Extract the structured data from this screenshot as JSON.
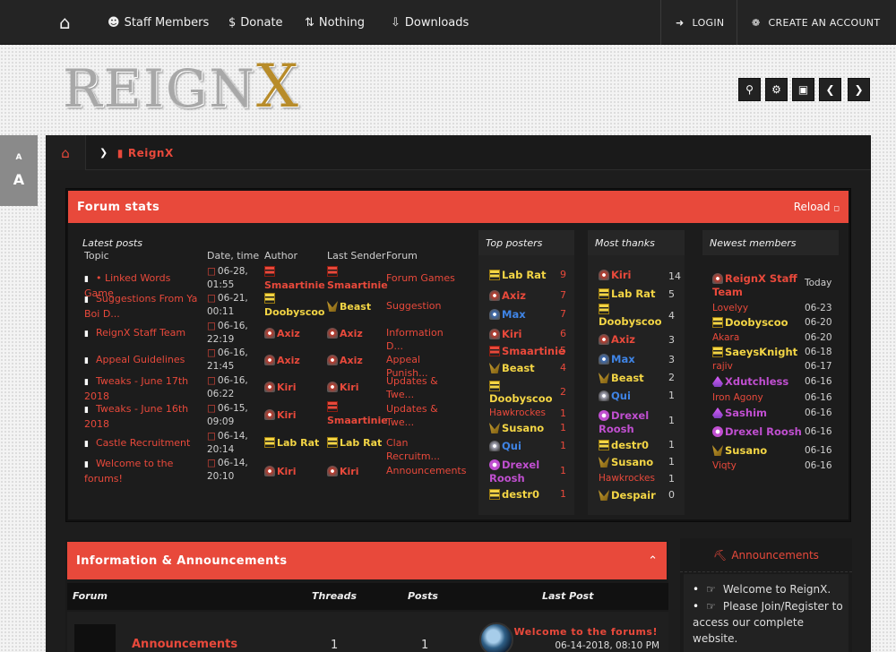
{
  "topnav": {
    "items": [
      {
        "label": "Staff Members",
        "icon": "users-icon"
      },
      {
        "label": "Donate",
        "icon": "dollar-icon"
      },
      {
        "label": "Nothing",
        "icon": "sort-icon"
      },
      {
        "label": "Downloads",
        "icon": "download-icon"
      }
    ],
    "login": "LOGIN",
    "create": "CREATE AN ACCOUNT"
  },
  "logo": {
    "text_main": "REIGN",
    "text_x": "X"
  },
  "font_size": {
    "small": "A",
    "large": "A"
  },
  "breadcrumb": {
    "label": "ReignX"
  },
  "forum_stats": {
    "title": "Forum stats",
    "reload": "Reload",
    "latest_posts": {
      "heading": "Latest posts",
      "columns": [
        "Topic",
        "Date, time",
        "Author",
        "Last Sender",
        "Forum"
      ],
      "rows": [
        {
          "topic": "• Linked Words Game",
          "date": "06-28, 01:55",
          "author": "Smaartinie",
          "sender": "Smaartinie",
          "forum": "Forum Games"
        },
        {
          "topic": "Suggestions From Ya Boi D...",
          "date": "06-21, 00:11",
          "author": "Doobyscoo",
          "sender": "Beast",
          "forum": "Suggestion"
        },
        {
          "topic": "ReignX Staff Team",
          "date": "06-16, 22:19",
          "author": "Axiz",
          "sender": "Axiz",
          "forum": "Information D..."
        },
        {
          "topic": "Appeal Guidelines",
          "date": "06-16, 21:45",
          "author": "Axiz",
          "sender": "Axiz",
          "forum": "Appeal Punish..."
        },
        {
          "topic": "Tweaks - June 17th 2018",
          "date": "06-16, 06:22",
          "author": "Kiri",
          "sender": "Kiri",
          "forum": "Updates & Twe..."
        },
        {
          "topic": "Tweaks - June 16th 2018",
          "date": "06-15, 09:09",
          "author": "Kiri",
          "sender": "Smaartinie",
          "forum": "Updates & Twe..."
        },
        {
          "topic": "Castle Recruitment",
          "date": "06-14, 20:14",
          "author": "Lab Rat",
          "sender": "Lab Rat",
          "forum": "Clan Recruitm..."
        },
        {
          "topic": "Welcome to the forums!",
          "date": "06-14, 20:10",
          "author": "Kiri",
          "sender": "Kiri",
          "forum": "Announcements"
        }
      ]
    },
    "top_posters": {
      "heading": "Top posters",
      "rows": [
        {
          "name": "Lab Rat",
          "count": "9"
        },
        {
          "name": "Axiz",
          "count": "7"
        },
        {
          "name": "Max",
          "count": "7"
        },
        {
          "name": "Kiri",
          "count": "6"
        },
        {
          "name": "Smaartinie",
          "count": "5"
        },
        {
          "name": "Beast",
          "count": "4"
        },
        {
          "name": "Doobyscoo",
          "count": "2"
        },
        {
          "name": "Hawkrockes",
          "count": "1"
        },
        {
          "name": "Susano",
          "count": "1"
        },
        {
          "name": "Qui",
          "count": "1"
        },
        {
          "name": "Drexel Roosh",
          "count": "1"
        },
        {
          "name": "destr0",
          "count": "1"
        }
      ]
    },
    "most_thanks": {
      "heading": "Most thanks",
      "rows": [
        {
          "name": "Kiri",
          "count": "14"
        },
        {
          "name": "Lab Rat",
          "count": "5"
        },
        {
          "name": "Doobyscoo",
          "count": "4"
        },
        {
          "name": "Axiz",
          "count": "3"
        },
        {
          "name": "Max",
          "count": "3"
        },
        {
          "name": "Beast",
          "count": "2"
        },
        {
          "name": "Qui",
          "count": "1"
        },
        {
          "name": "Drexel Roosh",
          "count": "1"
        },
        {
          "name": "destr0",
          "count": "1"
        },
        {
          "name": "Susano",
          "count": "1"
        },
        {
          "name": "Hawkrockes",
          "count": "1"
        },
        {
          "name": "Despair",
          "count": "0"
        }
      ]
    },
    "newest_members": {
      "heading": "Newest members",
      "rows": [
        {
          "name": "ReignX Staff Team",
          "date": "Today"
        },
        {
          "name": "Lovelyy",
          "date": "06-23"
        },
        {
          "name": "Doobyscoo",
          "date": "06-20"
        },
        {
          "name": "Akara",
          "date": "06-20"
        },
        {
          "name": "SaeysKnight",
          "date": "06-18"
        },
        {
          "name": "rajiv",
          "date": "06-17"
        },
        {
          "name": "Xdutchless",
          "date": "06-16"
        },
        {
          "name": "Iron Agony",
          "date": "06-16"
        },
        {
          "name": "Sashim",
          "date": "06-16"
        },
        {
          "name": "Drexel Roosh",
          "date": "06-16"
        },
        {
          "name": "Susano",
          "date": "06-16"
        },
        {
          "name": "Viqty",
          "date": "06-16"
        }
      ]
    }
  },
  "info_panel": {
    "title": "Information & Announcements",
    "columns": {
      "forum": "Forum",
      "threads": "Threads",
      "posts": "Posts",
      "last_post": "Last Post"
    },
    "rows": [
      {
        "forum": "Announcements",
        "threads": "1",
        "posts": "1",
        "last_title": "Welcome to the forums!",
        "last_date": "06-14-2018, 08:10 PM"
      }
    ]
  },
  "announcements": {
    "title": "Announcements",
    "items": [
      "Welcome to ReignX.",
      "Please Join/Register to access our complete website."
    ]
  },
  "colors": {
    "accent": "#e8493b",
    "dark": "#1d1d1d",
    "gold": "#f3d545"
  }
}
